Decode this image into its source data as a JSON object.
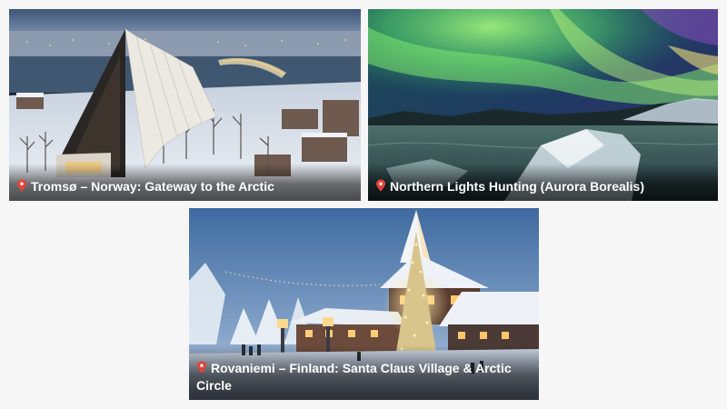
{
  "destinations": [
    {
      "caption": "Tromsø – Norway: Gateway to the Arctic",
      "pin_icon": "map-pin-icon",
      "pin_color": "#e0443a"
    },
    {
      "caption": "Northern Lights Hunting (Aurora Borealis)",
      "pin_icon": "map-pin-icon",
      "pin_color": "#e0443a"
    },
    {
      "caption": "Rovaniemi – Finland: Santa Claus Village & Arctic Circle",
      "pin_icon": "map-pin-icon",
      "pin_color": "#e0443a"
    }
  ],
  "colors": {
    "page_background": "#f6f6f6",
    "caption_text": "#ffffff",
    "aurora_green": "#6fe06a",
    "snow": "#e8eef6"
  }
}
